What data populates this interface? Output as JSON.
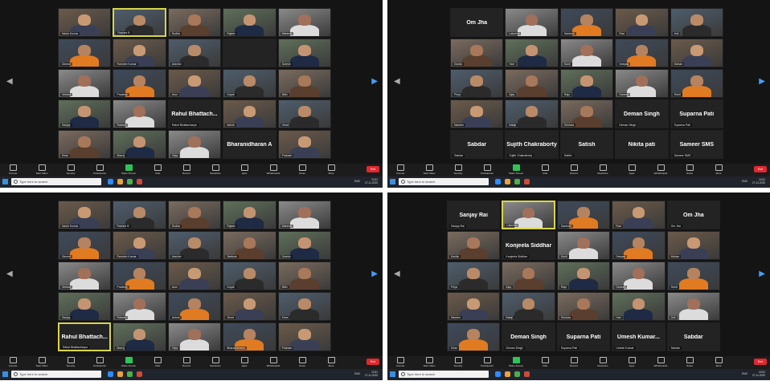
{
  "colors": {
    "accent": "#d8d44a",
    "end": "#e0282e",
    "taskbar": "#20242c"
  },
  "taskbar": {
    "search_placeholder": "Type here to search",
    "lang": "ENG",
    "time": "10:51",
    "date": "27-11-2020"
  },
  "toolbar": {
    "items": [
      "Unmute",
      "Start Video",
      "Security",
      "Participants",
      "Share Screen",
      "Chat",
      "Record",
      "Reactions",
      "Apps",
      "Whiteboards",
      "Notes",
      "More"
    ],
    "end_label": "End"
  },
  "quads": [
    {
      "cols": 5,
      "rows": 5,
      "tiles": [
        {
          "cap": "Navin Kumar"
        },
        {
          "cap": "Rashmi B",
          "active": true
        },
        {
          "cap": "Sudha"
        },
        {
          "cap": "Rajeev"
        },
        {
          "cap": "Mahesh"
        },
        {
          "cap": "Dinesh"
        },
        {
          "cap": "Ramesh Kumar"
        },
        {
          "cap": "Aravind"
        },
        {
          "cap": "",
          "dark": true
        },
        {
          "cap": "Suresh"
        },
        {
          "cap": "Venkat"
        },
        {
          "cap": "Pradeep"
        },
        {
          "cap": "Arun"
        },
        {
          "cap": "Gopal"
        },
        {
          "cap": "Nitin"
        },
        {
          "cap": "Sanjay"
        },
        {
          "cap": "Rakesh"
        },
        {
          "big": "Rahul  Bhattach...",
          "cap": "Rahul Bhattacharya",
          "dark": true
        },
        {
          "cap": "Ashok"
        },
        {
          "cap": "Vinod"
        },
        {
          "cap": "Kiran"
        },
        {
          "cap": "Manoj"
        },
        {
          "cap": "Vijay"
        },
        {
          "big": "Bharanidharan A",
          "dark": true
        },
        {
          "cap": "Prakash"
        }
      ]
    },
    {
      "cols": 5,
      "rows": 5,
      "tiles": [
        {
          "big": "Om Jha",
          "dark": true
        },
        {
          "cap": "Lakshmi"
        },
        {
          "cap": "Santosh"
        },
        {
          "cap": "Ravi"
        },
        {
          "cap": "Anil"
        },
        {
          "cap": "Kavita"
        },
        {
          "cap": "Hari"
        },
        {
          "cap": "Sunil"
        },
        {
          "cap": "Deepak"
        },
        {
          "cap": "Mohan"
        },
        {
          "cap": "Priya"
        },
        {
          "cap": "Ajay"
        },
        {
          "cap": "Raju"
        },
        {
          "cap": "Ganesh"
        },
        {
          "cap": "Rohit"
        },
        {
          "cap": "Naveen"
        },
        {
          "cap": "Balaji"
        },
        {
          "cap": "Srinivas"
        },
        {
          "big": "Deman Singh",
          "cap": "Deman Singh",
          "dark": true
        },
        {
          "big": "Suparna Pati",
          "cap": "Suparna Pati",
          "dark": true
        },
        {
          "big": "Sabdar",
          "cap": "Sabdar",
          "dark": true
        },
        {
          "big": "Sujith Chakraborty",
          "cap": "Sujith Chakraborty",
          "dark": true
        },
        {
          "big": "Satish",
          "cap": "Satish",
          "dark": true
        },
        {
          "big": "Nikita pati",
          "dark": true
        },
        {
          "big": "Sameer SMS",
          "cap": "Sameer SMS",
          "dark": true
        }
      ]
    },
    {
      "cols": 5,
      "rows": 5,
      "tiles": [
        {
          "cap": "Navin Kumar"
        },
        {
          "cap": "Rashmi B"
        },
        {
          "cap": "Sudha"
        },
        {
          "cap": "Rajeev"
        },
        {
          "cap": "Mahesh"
        },
        {
          "cap": "Dinesh"
        },
        {
          "cap": "Ramesh Kumar"
        },
        {
          "cap": "Aravind"
        },
        {
          "cap": "Santosh"
        },
        {
          "cap": "Suresh"
        },
        {
          "cap": "Venkat"
        },
        {
          "cap": "Pradeep"
        },
        {
          "cap": "Arun"
        },
        {
          "cap": "Gopal"
        },
        {
          "cap": "Nitin"
        },
        {
          "cap": "Sanjay"
        },
        {
          "cap": "Rakesh"
        },
        {
          "cap": "Ashok"
        },
        {
          "cap": "Vinod"
        },
        {
          "cap": "Kiran"
        },
        {
          "big": "Rahul  Bhattach...",
          "cap": "Rahul Bhattacharya",
          "dark": true,
          "active": true
        },
        {
          "cap": "Manoj"
        },
        {
          "cap": "Vijay"
        },
        {
          "cap": "Bharanidharan"
        },
        {
          "cap": "Prakash"
        }
      ]
    },
    {
      "cols": 5,
      "rows": 5,
      "tiles": [
        {
          "big": "Sanjay Rai",
          "cap": "Sanjay Rai",
          "dark": true
        },
        {
          "cap": "Lakshmi",
          "active": true
        },
        {
          "cap": "Santosh"
        },
        {
          "cap": "Ravi"
        },
        {
          "big": "Om Jha",
          "cap": "Om Jha",
          "dark": true
        },
        {
          "cap": "Kavita"
        },
        {
          "big": "Konjeela Siddhar",
          "cap": "Konjeela Siddhar",
          "dark": true
        },
        {
          "cap": "Sunil"
        },
        {
          "cap": "Deepak"
        },
        {
          "cap": "Mohan"
        },
        {
          "cap": "Priya"
        },
        {
          "cap": "Ajay"
        },
        {
          "cap": "Raju"
        },
        {
          "cap": "Ganesh"
        },
        {
          "cap": "Rohit"
        },
        {
          "cap": "Naveen"
        },
        {
          "cap": "Balaji"
        },
        {
          "cap": "Srinivas"
        },
        {
          "cap": "Hari"
        },
        {
          "cap": "Anil"
        },
        {
          "cap": "Kiran"
        },
        {
          "big": "Deman Singh",
          "cap": "Deman Singh",
          "dark": true
        },
        {
          "big": "Suparna Pati",
          "cap": "Suparna Pati",
          "dark": true
        },
        {
          "big": "Umesh  Kumar...",
          "cap": "Umesh Kumar",
          "dark": true
        },
        {
          "big": "Sabdar",
          "cap": "Sabdar",
          "dark": true
        }
      ]
    }
  ]
}
